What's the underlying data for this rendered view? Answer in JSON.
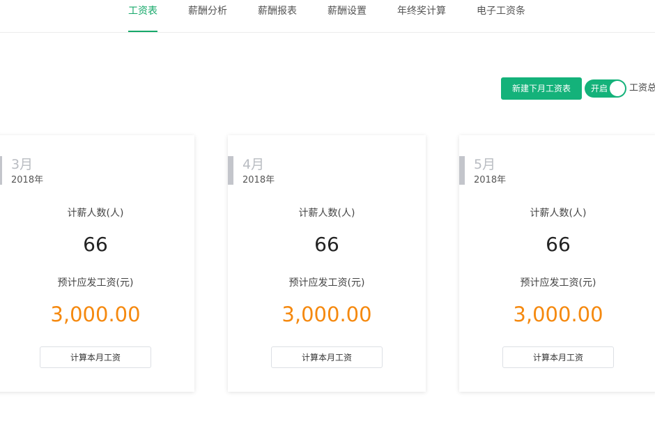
{
  "tabs": [
    {
      "label": "工资表",
      "active": true
    },
    {
      "label": "薪酬分析",
      "active": false
    },
    {
      "label": "薪酬报表",
      "active": false
    },
    {
      "label": "薪酬设置",
      "active": false
    },
    {
      "label": "年终奖计算",
      "active": false
    },
    {
      "label": "电子工资条",
      "active": false
    }
  ],
  "toolbar": {
    "new_button_label": "新建下月工资表",
    "toggle_text": "开启",
    "toggle_on": true,
    "toggle_label": "工资总"
  },
  "labels": {
    "count_label": "计薪人数(人)",
    "salary_label": "预计应发工资(元)",
    "calc_button_label": "计算本月工资"
  },
  "cards": [
    {
      "month": "3月",
      "year": "2018年",
      "count": "66",
      "amount": "3,000.00"
    },
    {
      "month": "4月",
      "year": "2018年",
      "count": "66",
      "amount": "3,000.00"
    },
    {
      "month": "5月",
      "year": "2018年",
      "count": "66",
      "amount": "3,000.00"
    }
  ],
  "colors": {
    "accent": "#14b27a",
    "amount": "#f5890f",
    "month_muted": "#b9bcc2"
  }
}
